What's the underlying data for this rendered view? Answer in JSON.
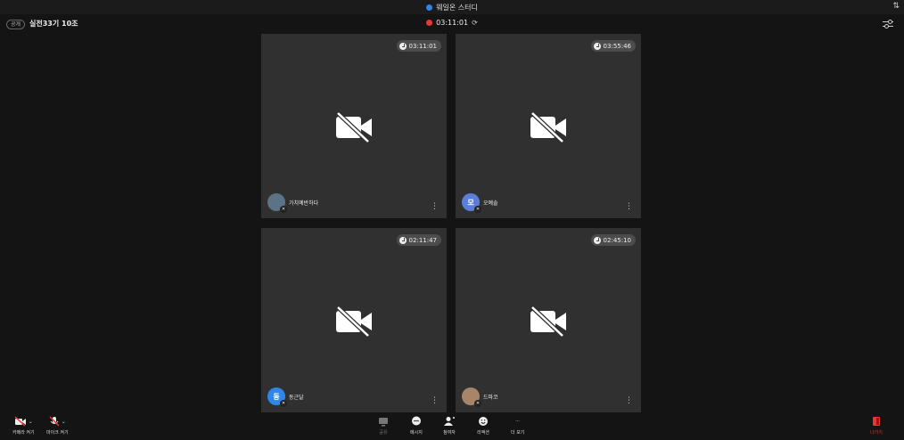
{
  "titlebar": {
    "title": "웨일온 스터디",
    "sort_icon": "sort-icon"
  },
  "subbar": {
    "badge": "공개",
    "room": "실전33기 10조",
    "recording_time": "03:11:01"
  },
  "tiles": [
    {
      "timer": "03:11:01",
      "name": "가치예반하다",
      "avatar_letter": "",
      "avatar_color": "#5b7287"
    },
    {
      "timer": "03:55:46",
      "name": "오예솔",
      "avatar_letter": "모",
      "avatar_color": "#5b7fd8"
    },
    {
      "timer": "02:11:47",
      "name": "동근달",
      "avatar_letter": "동",
      "avatar_color": "#2f86e6"
    },
    {
      "timer": "02:45:10",
      "name": "드파코",
      "avatar_letter": "",
      "avatar_color": "#a88468"
    }
  ],
  "toolbar": {
    "camera": "카메라 켜기",
    "mic": "마이크 켜기",
    "share": "공유",
    "message": "메시지",
    "participants": "참여자",
    "reaction": "리액션",
    "more": "더 보기",
    "leave": "나가기"
  },
  "colors": {
    "accent": "#2f86e6",
    "record": "#e53935",
    "tile_bg": "#303030"
  }
}
